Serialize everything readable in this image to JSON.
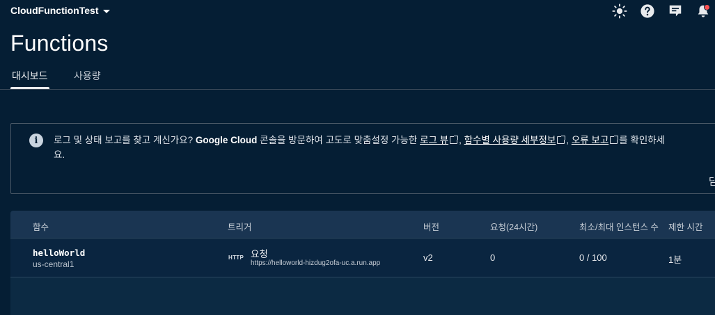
{
  "header": {
    "project_name": "CloudFunctionTest",
    "icons": [
      "theme-icon",
      "help-icon",
      "feedback-icon",
      "notifications-icon"
    ]
  },
  "page": {
    "title": "Functions"
  },
  "tabs": [
    {
      "label": "대시보드",
      "active": true
    },
    {
      "label": "사용량",
      "active": false
    }
  ],
  "banner": {
    "text_start": "로그 및 상태 보고를 찾고 계신가요? ",
    "google_cloud": "Google Cloud",
    "text_mid": " 콘솔을 방문하여 고도로 맞춤설정 가능한 ",
    "link_logs": "로그 뷰",
    "sep1": ", ",
    "link_usage": "함수별 사용량 세부정보",
    "sep2": ", ",
    "link_errors": "오류 보고",
    "text_end": "를 확인하세",
    "line2": "요.",
    "dismiss_label": "닫"
  },
  "table": {
    "headers": [
      "함수",
      "트리거",
      "버전",
      "요청(24시간)",
      "최소/최대 인스턴스 수",
      "제한 시간"
    ],
    "rows": [
      {
        "name": "helloWorld",
        "region": "us-central1",
        "trigger_badge": "HTTP",
        "trigger_type": "요청",
        "trigger_url": "https://helloworld-hizdug2ofa-uc.a.run.app",
        "version": "v2",
        "requests": "0",
        "instances": "0 / 100",
        "timeout": "1분"
      }
    ]
  },
  "colors": {
    "background": "#051e34",
    "table_header": "#1a3552",
    "notification": "#ff5252"
  }
}
